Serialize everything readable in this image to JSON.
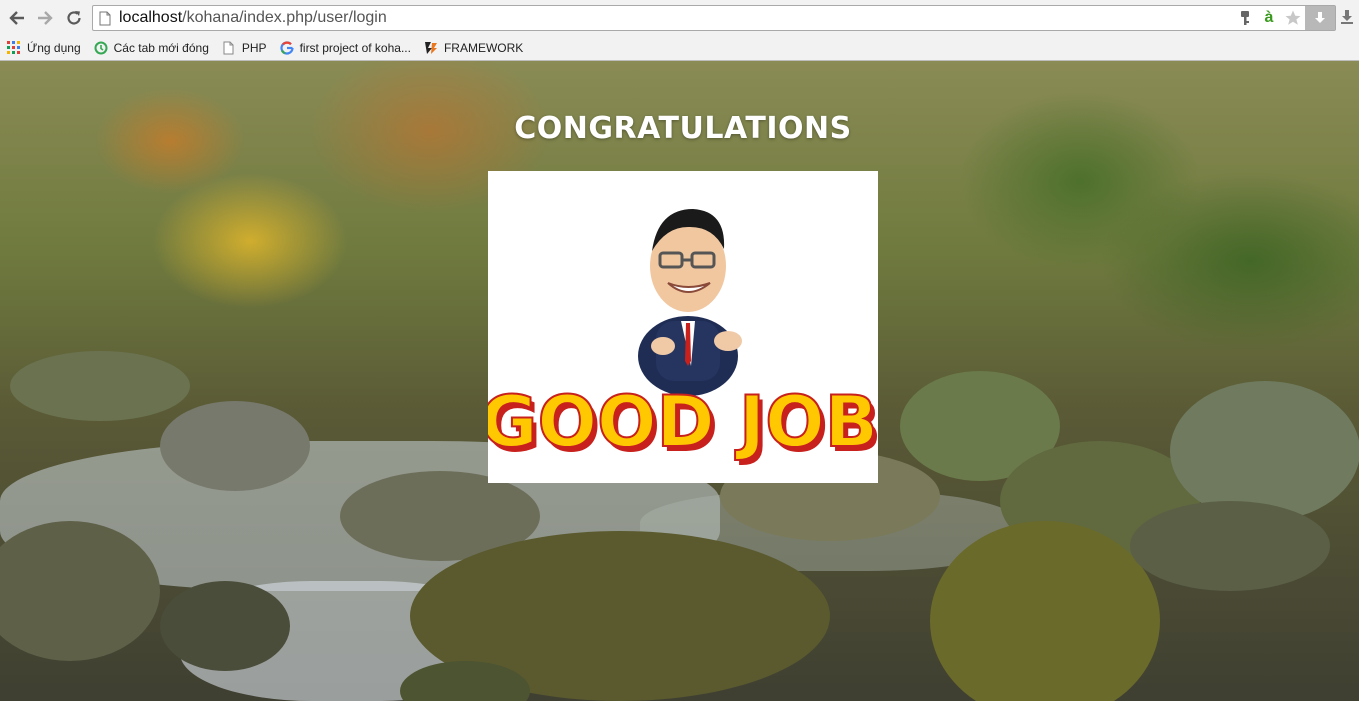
{
  "browser": {
    "url_host": "localhost",
    "url_path": "/kohana/index.php/user/login",
    "icons": {
      "back": "back-arrow-icon",
      "forward": "forward-arrow-icon",
      "reload": "reload-icon",
      "page": "page-icon",
      "ext_key": "key-icon",
      "ext_a": "à",
      "star": "star-icon",
      "download": "download-icon"
    }
  },
  "bookmarks": [
    {
      "label": "Ứng dụng",
      "icon": "apps-grid-icon"
    },
    {
      "label": "Các tab mới đóng",
      "icon": "recent-tabs-icon"
    },
    {
      "label": "PHP",
      "icon": "page-icon"
    },
    {
      "label": "first project of koha...",
      "icon": "google-icon"
    },
    {
      "label": "FRAMEWORK",
      "icon": "framework-icon"
    }
  ],
  "page": {
    "title": "CONGRATULATIONS",
    "image_text": "GOOD JOB"
  },
  "colors": {
    "image_text_fill": "#ffc800",
    "image_text_stroke": "#c8201c",
    "title": "#ffffff"
  }
}
